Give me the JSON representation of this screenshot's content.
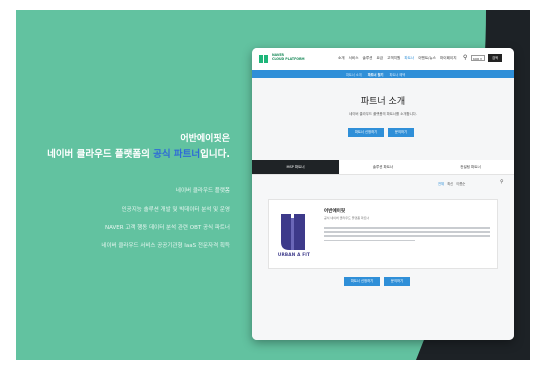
{
  "hero": {
    "line1": "어반에이핏은",
    "line2_pre": "네이버 클라우드 플랫폼의 ",
    "line2_highlight": "공식 파트너",
    "line2_post": "입니다.",
    "bullets": [
      "네이버 클라우드 플랫폼",
      "인공지능 솔루션 개발 및 빅데이터 분석 및 운영",
      "NAVER 고객 행동 데이터 분석 관련 OBT 공식 파트너",
      "네이버 클라우드 서비스 공공기관형 IaaS 전문자격 획득"
    ]
  },
  "site": {
    "logo_text_top": "NAVER",
    "logo_text_bottom": "CLOUD PLATFORM",
    "nav": [
      "소개",
      "서비스",
      "솔루션",
      "요금",
      "고객지원",
      "파트너",
      "이벤트/뉴스",
      "마이페이지"
    ],
    "nav_active_index": 5,
    "lang": "KOR ▾",
    "lang_button": "검색",
    "subnav": [
      "파트너 소개",
      "파트너 찾기",
      "파트너 혜택"
    ],
    "subnav_active_index": 1,
    "intro_title": "파트너 소개",
    "intro_sub": "네이버 클라우드 플랫폼의 파트너를 소개합니다.",
    "intro_buttons": [
      "파트너 신청하기",
      "문의하기"
    ],
    "tabs": [
      "MSP 파트너",
      "솔루션 파트너",
      "컨설팅 파트너"
    ],
    "tab_active_index": 0,
    "filter": [
      "전체",
      "최신",
      "이름순"
    ],
    "filter_active_index": 0,
    "card": {
      "logo_text": "URBAN A FIT",
      "title": "어반에이핏",
      "subtitle": "공식 네이버 클라우드 플랫폼 파트너",
      "line_count": 4
    },
    "bottom_buttons": [
      "파트너 신청하기",
      "문의하기"
    ]
  },
  "colors": {
    "accent_green": "#62c2a0",
    "dark": "#1d2226",
    "brand_blue": "#2f8fd8",
    "logo_purple": "#3d3a8a"
  }
}
